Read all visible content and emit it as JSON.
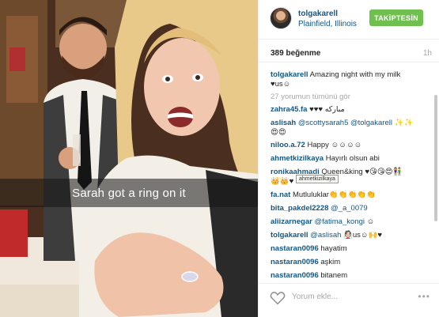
{
  "photo": {
    "caption": "Sarah got a ring on it"
  },
  "header": {
    "username": "tolgakarell",
    "location": "Plainfield, Illinois",
    "follow_label": "TAKİPTESİN",
    "follow_color": "#70c050",
    "avatar_icon": "avatar"
  },
  "stats": {
    "likes": "389 beğenme",
    "time": "1h"
  },
  "caption_comment": {
    "user": "tolgakarell",
    "text_line1": "Amazing night with my milk",
    "text_line2": "♥us☺"
  },
  "view_all": "27 yorumun tümünü gör",
  "comments": [
    {
      "user": "zahra45.fa",
      "text": "♥♥♥ مبارکه"
    },
    {
      "user": "aslisah",
      "mention1": "@scottysarah5",
      "mention2": "@tolgakarell",
      "text": "✨✨",
      "text_line2": "😍😍"
    },
    {
      "user": "niloo.a.72",
      "text": "Happy ☺☺☺☺"
    },
    {
      "user": "ahmetkizilkaya",
      "text": "Hayırlı olsun abi"
    },
    {
      "user": "ronikaahmadi",
      "text": "Queen&king ♥😘😘😍👫",
      "text_line2": "👑👑♥"
    },
    {
      "user": "fa.nat",
      "text": "Mutluluklar👏👏👏👏👏"
    },
    {
      "user": "bita_pakdel2228",
      "mention1": "@_a_0079",
      "text": ""
    },
    {
      "user": "aliizarnegar",
      "mention1": "@fatima_kongi",
      "text": "☺"
    },
    {
      "user": "tolgakarell",
      "mention1": "@aslisah",
      "text": "👰🏻us☺🙌♥"
    },
    {
      "user": "nastaran0096",
      "text": "hayatim"
    },
    {
      "user": "nastaran0096",
      "text": "aşkim"
    },
    {
      "user": "nastaran0096",
      "text": "bitanem"
    }
  ],
  "tooltip": "ahmetkizilkaya",
  "footer": {
    "comment_placeholder": "Yorum ekle...",
    "more_label": "•••",
    "heart_icon": "heart-outline"
  },
  "colors": {
    "link": "#125688",
    "muted": "#a5a7aa"
  }
}
